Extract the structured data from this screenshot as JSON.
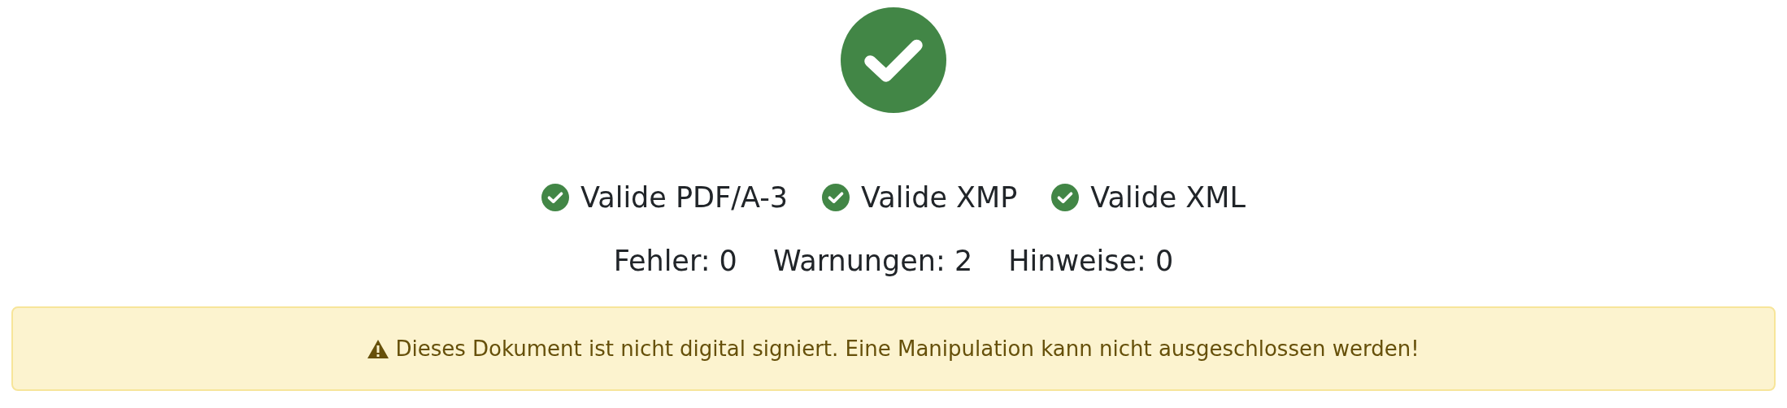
{
  "result": {
    "valid": true
  },
  "checks": [
    {
      "label": "Valide PDF/A-3",
      "valid": true
    },
    {
      "label": "Valide XMP",
      "valid": true
    },
    {
      "label": "Valide XML",
      "valid": true
    }
  ],
  "counts": [
    {
      "label": "Fehler:",
      "value": "0"
    },
    {
      "label": "Warnungen:",
      "value": "2"
    },
    {
      "label": "Hinweise:",
      "value": "0"
    }
  ],
  "alert": {
    "kind": "warning",
    "text": "Dieses Dokument ist nicht digital signiert. Eine Manipulation kann nicht ausgeschlossen werden!"
  }
}
